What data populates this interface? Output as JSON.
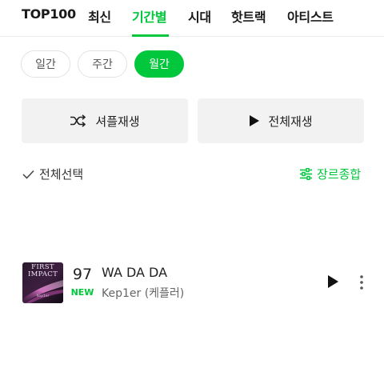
{
  "tabs": [
    {
      "label": "TOP100",
      "active": false
    },
    {
      "label": "최신",
      "active": false
    },
    {
      "label": "기간별",
      "active": true
    },
    {
      "label": "시대",
      "active": false
    },
    {
      "label": "핫트랙",
      "active": false
    },
    {
      "label": "아티스트",
      "active": false
    }
  ],
  "periods": [
    {
      "label": "일간",
      "active": false
    },
    {
      "label": "주간",
      "active": false
    },
    {
      "label": "월간",
      "active": true
    }
  ],
  "actions": {
    "shuffle_label": "셔플재생",
    "play_all_label": "전체재생"
  },
  "list_controls": {
    "select_all_label": "전체선택",
    "genre_label": "장르종합"
  },
  "songs": [
    {
      "rank": "97",
      "badge": "NEW",
      "title": "WA DA DA",
      "artist": "Kep1er (케플러)",
      "album_art_text": "FIRST\nIMPACT",
      "album_art_sub": "Kep1er"
    }
  ],
  "colors": {
    "accent": "#00c73c",
    "button_bg": "#f2f2f2",
    "text_primary": "#222222",
    "text_secondary": "#666666"
  },
  "icons": {
    "shuffle": "shuffle-icon",
    "play": "play-icon",
    "check": "check-icon",
    "filter": "sliders-icon",
    "more": "more-vertical-icon"
  }
}
